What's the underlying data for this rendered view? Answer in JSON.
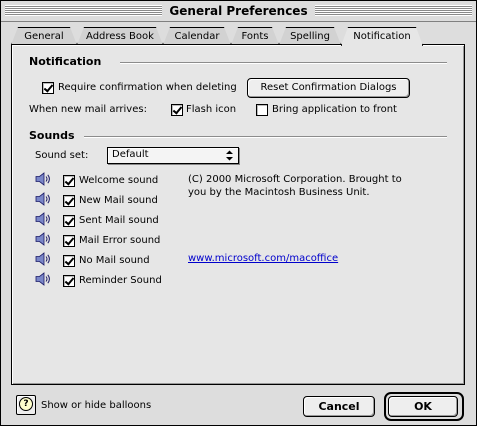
{
  "window": {
    "title": "General Preferences"
  },
  "tabs": [
    "General",
    "Address Book",
    "Calendar",
    "Fonts",
    "Spelling",
    "Notification"
  ],
  "active_tab": "Notification",
  "notification": {
    "heading": "Notification",
    "require_confirmation": {
      "label": "Require confirmation when deleting",
      "checked": true
    },
    "reset_button": "Reset Confirmation Dialogs",
    "new_mail_label": "When new mail arrives:",
    "flash_icon": {
      "label": "Flash icon",
      "checked": true
    },
    "bring_to_front": {
      "label": "Bring application to front",
      "checked": false
    }
  },
  "sounds": {
    "heading": "Sounds",
    "sound_set_label": "Sound set:",
    "sound_set_value": "Default",
    "items": [
      {
        "label": "Welcome sound",
        "checked": true
      },
      {
        "label": "New Mail sound",
        "checked": true
      },
      {
        "label": "Sent Mail sound",
        "checked": true
      },
      {
        "label": "Mail Error sound",
        "checked": true
      },
      {
        "label": "No Mail sound",
        "checked": true
      },
      {
        "label": "Reminder Sound",
        "checked": true
      }
    ],
    "copyright": "(C) 2000 Microsoft Corporation. Brought to you by the Macintosh Business Unit.",
    "link": "www.microsoft.com/macoffice"
  },
  "footer": {
    "help_label": "Show or hide balloons",
    "cancel": "Cancel",
    "ok": "OK"
  },
  "icons": {
    "speaker": "speaker-icon",
    "help": "help-balloon-icon",
    "popup_arrows": "updown-arrows-icon"
  }
}
